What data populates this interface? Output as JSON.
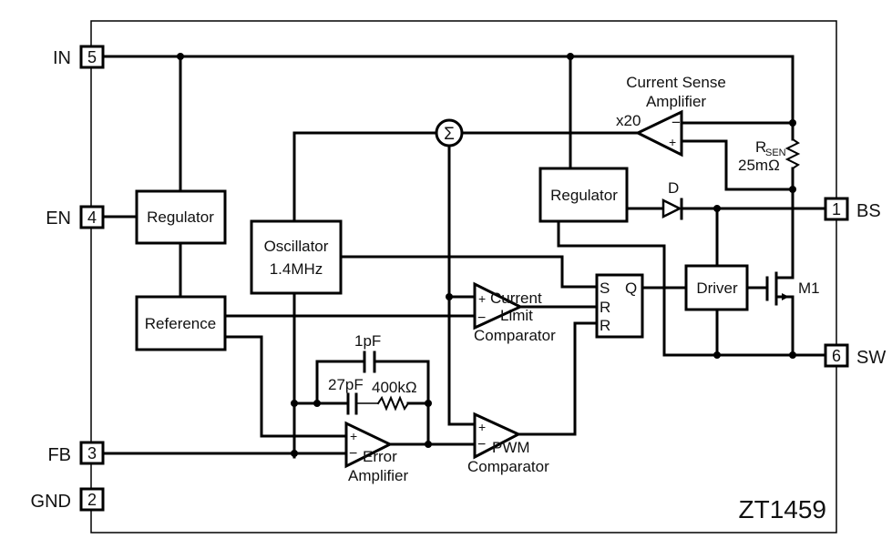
{
  "chip": {
    "part_number": "ZT1459"
  },
  "pins": {
    "in": {
      "name": "IN",
      "number": "5"
    },
    "en": {
      "name": "EN",
      "number": "4"
    },
    "fb": {
      "name": "FB",
      "number": "3"
    },
    "gnd": {
      "name": "GND",
      "number": "2"
    },
    "bs": {
      "name": "BS",
      "number": "1"
    },
    "sw": {
      "name": "SW",
      "number": "6"
    }
  },
  "blocks": {
    "regulator_left": "Regulator",
    "reference": "Reference",
    "oscillator_line1": "Oscillator",
    "oscillator_line2": "1.4MHz",
    "regulator_right": "Regulator",
    "driver": "Driver",
    "summer": "Σ"
  },
  "amplifiers": {
    "current_sense_line1": "Current Sense",
    "current_sense_line2": "Amplifier",
    "current_sense_gain": "x20",
    "current_limit_line1": "Current",
    "current_limit_line2": "Limit",
    "current_limit_line3": "Comparator",
    "error_line1": "Error",
    "error_line2": "Amplifier",
    "pwm_line1": "PWM",
    "pwm_line2": "Comparator",
    "plus": "+",
    "minus": "−"
  },
  "latch": {
    "s": "S",
    "r1": "R",
    "r2": "R",
    "q": "Q"
  },
  "components": {
    "rsen_name": "R",
    "rsen_sub": "SEN",
    "rsen_value": "25mΩ",
    "diode": "D",
    "mosfet": "M1",
    "cap_1": "1pF",
    "cap_2": "27pF",
    "res_comp": "400kΩ"
  }
}
